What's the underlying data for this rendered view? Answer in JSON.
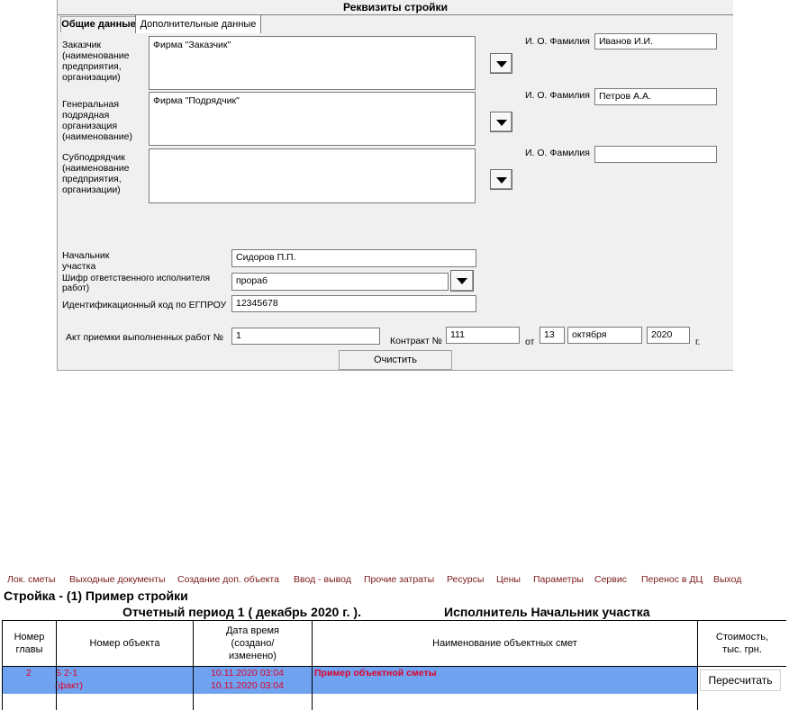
{
  "dialog": {
    "title": "Реквизиты стройки",
    "tabs": [
      "Общие данные",
      "Дополнительные данные"
    ],
    "customer": {
      "label": "Заказчик\n(наименование\nпредприятия,\nорганизации)",
      "value": "Фирма \"Заказчик\"",
      "fio_label": "И. О. Фамилия",
      "fio_value": "Иванов И.И."
    },
    "general_contractor": {
      "label": "Генеральная\nподрядная\nорганизация\n(наименование)",
      "value": "Фирма \"Подрядчик\"",
      "fio_label": "И. О. Фамилия",
      "fio_value": "Петров А.А."
    },
    "subcontractor": {
      "label": "Субподрядчик\n(наименование\nпредприятия,\nорганизации)",
      "value": "",
      "fio_label": "И. О. Фамилия",
      "fio_value": ""
    },
    "site_manager": {
      "label": "Начальник\nучастка",
      "value": "Сидоров П.П."
    },
    "executor_code": {
      "label": "Шифр ответственного исполнителя\nработ)",
      "value": "прораб"
    },
    "egrpou": {
      "label": "Идентификационный код по ЕГПРОУ",
      "value": "12345678"
    },
    "act": {
      "label": "Акт приемки выполненных работ №",
      "value": "1"
    },
    "contract": {
      "label": "Контракт №",
      "value": "111",
      "from_label": "от",
      "day": "13",
      "month": "октября",
      "year": "2020",
      "year_suffix": "г."
    },
    "clear_button": "Очистить"
  },
  "menu": [
    "Лок. сметы",
    "Выходные документы",
    "Создание доп. объекта",
    "Ввод - вывод",
    "Прочие затраты",
    "Ресурсы",
    "Цены",
    "Параметры",
    "Сервис",
    "Перенос в ДЦ",
    "Выход"
  ],
  "app": {
    "project_title": "Стройка - (1) Пример стройки",
    "period": "Отчетный период 1   ( декабрь  2020 г. ).",
    "executor": "Исполнитель Начальник участка",
    "columns": [
      "Номер\nглавы",
      "Номер объекта",
      "Дата время\n(создано/\nизменено)",
      "Наименование объектных смет",
      "Стоимость,\nтыс. грн."
    ],
    "row": {
      "chapter": "2",
      "object_line1": "S 2-1",
      "object_line2": "(факт)",
      "date1": "10.11.2020 03:04",
      "date2": "10.11.2020 03:04",
      "name": "Пример объектной сметы"
    },
    "recalc_button": "Пересчитать"
  },
  "colors": {
    "selection": "#6fa3f0",
    "row_text": "#e0002a",
    "menu_text": "#7a1a1a",
    "dialog_bg": "#f0f0f0"
  }
}
